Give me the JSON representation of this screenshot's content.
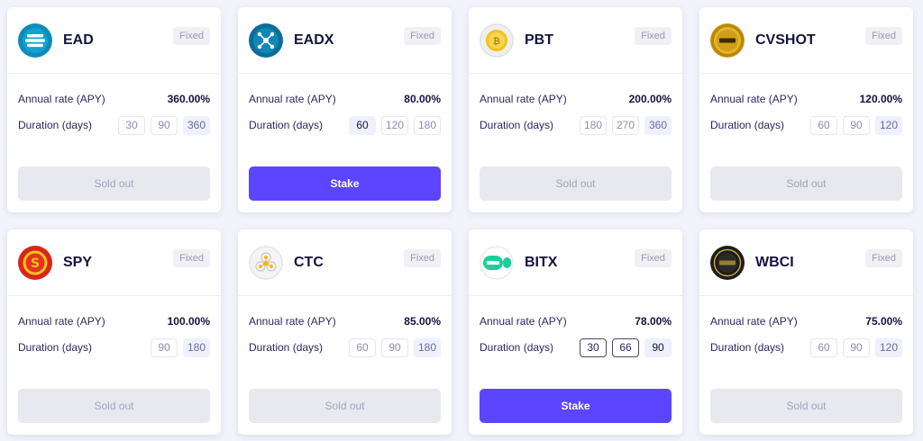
{
  "labels": {
    "annual_rate": "Annual rate (APY)",
    "duration": "Duration (days)",
    "badge": "Fixed",
    "sold_out": "Sold out",
    "stake": "Stake"
  },
  "colors": {
    "accent": "#5c45ff",
    "sold_out_bg": "#e8e8ef",
    "background": "#f3f3fb"
  },
  "cards": [
    {
      "name": "EAD",
      "icon": "ead-logo-icon",
      "apy": "360.00%",
      "durations": [
        "30",
        "90",
        "360"
      ],
      "selected": 2,
      "status": "sold_out"
    },
    {
      "name": "EADX",
      "icon": "eadx-logo-icon",
      "apy": "80.00%",
      "durations": [
        "60",
        "120",
        "180"
      ],
      "selected": 0,
      "status": "stake"
    },
    {
      "name": "PBT",
      "icon": "pbt-logo-icon",
      "apy": "200.00%",
      "durations": [
        "180",
        "270",
        "360"
      ],
      "selected": 2,
      "status": "sold_out"
    },
    {
      "name": "CVSHOT",
      "icon": "cvshot-logo-icon",
      "apy": "120.00%",
      "durations": [
        "60",
        "90",
        "120"
      ],
      "selected": 2,
      "status": "sold_out"
    },
    {
      "name": "SPY",
      "icon": "spy-logo-icon",
      "apy": "100.00%",
      "durations": [
        "90",
        "180"
      ],
      "selected": 1,
      "status": "sold_out"
    },
    {
      "name": "CTC",
      "icon": "ctc-logo-icon",
      "apy": "85.00%",
      "durations": [
        "60",
        "90",
        "180"
      ],
      "selected": 2,
      "status": "sold_out"
    },
    {
      "name": "BITX",
      "icon": "bitx-logo-icon",
      "apy": "78.00%",
      "durations": [
        "30",
        "66",
        "90"
      ],
      "selected": 2,
      "status": "stake"
    },
    {
      "name": "WBCI",
      "icon": "wbci-logo-icon",
      "apy": "75.00%",
      "durations": [
        "60",
        "90",
        "120"
      ],
      "selected": 2,
      "status": "sold_out"
    }
  ]
}
